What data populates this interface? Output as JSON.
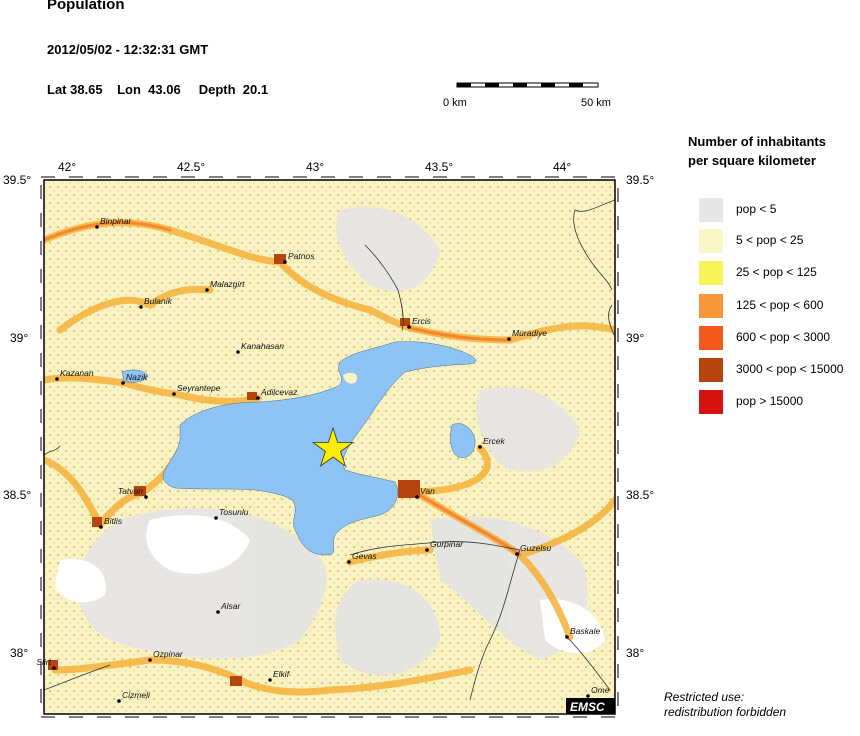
{
  "header": {
    "title": "Population",
    "datetime": "2012/05/02 - 12:32:31 GMT",
    "coords": "Lat 38.65    Lon  43.06     Depth  20.1"
  },
  "scale": {
    "left_label": "0 km",
    "right_label": "50 km"
  },
  "legend": {
    "title_line1": "Number of inhabitants",
    "title_line2": "per square kilometer",
    "items": [
      {
        "label": "pop < 5",
        "color": "#e6e6e6"
      },
      {
        "label": "5 < pop < 25",
        "color": "#fbf6c5"
      },
      {
        "label": "25 < pop < 125",
        "color": "#f9f45a"
      },
      {
        "label": "125 < pop < 600",
        "color": "#f8973a"
      },
      {
        "label": "600 < pop < 3000",
        "color": "#f4591c"
      },
      {
        "label": "3000 < pop < 15000",
        "color": "#b5440f"
      },
      {
        "label": "pop > 15000",
        "color": "#d61313"
      }
    ]
  },
  "axes": {
    "x_ticks": [
      "42°",
      "42.5°",
      "43°",
      "43.5°",
      "44°"
    ],
    "y_ticks_left": [
      "39.5°",
      "39°",
      "38.5°",
      "38°"
    ],
    "y_ticks_right": [
      "39.5°",
      "39°",
      "38.5°",
      "38°"
    ]
  },
  "places": [
    "Binpinar",
    "Patnos",
    "Malazgirt",
    "Bulanik",
    "Ercis",
    "Muradiye",
    "Kanahasan",
    "Kazanan",
    "Nazik",
    "Seyrantepe",
    "Adilcevaz",
    "Ercek",
    "Tatvan",
    "Van",
    "Bitlis",
    "Tosunlu",
    "Gevas",
    "Gurpinar",
    "Guzelsu",
    "Alsar",
    "Baskale",
    "Siirt",
    "Ozpinar",
    "Elkif",
    "Cizmeli",
    "Ome"
  ],
  "footer": {
    "line1": "Restricted use:",
    "line2": "redistribution forbidden"
  },
  "brand": "EMSC",
  "colors": {
    "water": "#8ec3f5",
    "land": "#f7f3c6",
    "epicenter": "#ffee00"
  }
}
